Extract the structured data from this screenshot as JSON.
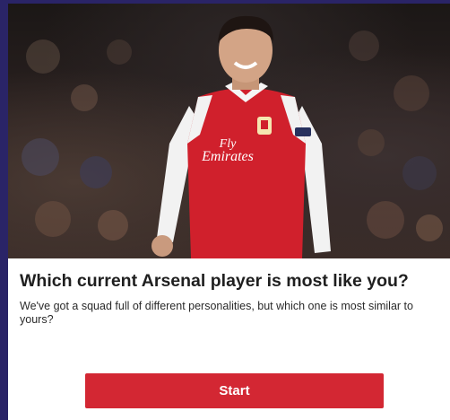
{
  "hero": {
    "image_subject": "smiling player in red and white home kit",
    "shirt_sponsor_line1": "Fly",
    "shirt_sponsor_line2": "Emirates"
  },
  "quiz": {
    "title": "Which current Arsenal player is most like you?",
    "description": "We've got a squad full of different personalities, but which one is most similar to yours?",
    "start_label": "Start"
  },
  "colors": {
    "page_background": "#2a2467",
    "card_background": "#ffffff",
    "start_button": "#d32733",
    "kit_red": "#d0202c"
  }
}
